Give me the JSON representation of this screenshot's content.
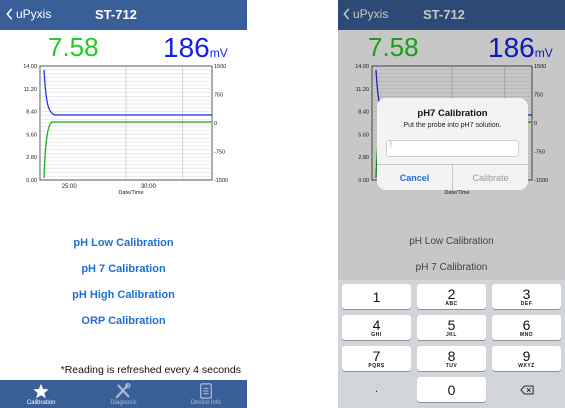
{
  "left": {
    "nav": {
      "back_label": "uPyxis",
      "title": "ST-712"
    },
    "readings": {
      "ph": "7.58",
      "mv": "186",
      "mv_unit": "mV"
    },
    "chart": {
      "left_ticks": [
        "14.00",
        "11.20",
        "8.40",
        "5.60",
        "2.80",
        "0.00"
      ],
      "right_ticks": [
        "1500",
        "750",
        "0",
        "-750",
        "-1500"
      ],
      "x_ticks": [
        "25:00",
        "30:00"
      ],
      "xlabel": "Date/Time"
    },
    "menu": [
      "pH Low Calibration",
      "pH 7 Calibration",
      "pH High Calibration",
      "ORP Calibration"
    ],
    "note": "*Reading is refreshed every 4 seconds",
    "tabs": [
      {
        "label": "Calibration",
        "icon": "star-icon",
        "active": true
      },
      {
        "label": "Diagnosis",
        "icon": "tools-icon",
        "active": false
      },
      {
        "label": "Device Info",
        "icon": "device-info-icon",
        "active": false
      }
    ]
  },
  "right": {
    "nav": {
      "back_label": "uPyxis",
      "title": "ST-712"
    },
    "readings": {
      "ph": "7.58",
      "mv": "186",
      "mv_unit": "mV"
    },
    "chart": {
      "left_ticks": [
        "14.00",
        "11.20",
        "8.40",
        "5.60",
        "2.80",
        "0.00"
      ],
      "right_ticks": [
        "1500",
        "750",
        "0",
        "-750",
        "-1500"
      ],
      "xlabel": "Date/Time"
    },
    "dialog": {
      "title": "pH7 Calibration",
      "message": "Put the probe into pH7 solution.",
      "input_value": "",
      "input_placeholder": "|",
      "cancel_label": "Cancel",
      "calibrate_label": "Calibrate"
    },
    "menu_behind": [
      "pH Low Calibration",
      "pH 7 Calibration"
    ],
    "keypad": [
      {
        "digit": "1",
        "letters": ""
      },
      {
        "digit": "2",
        "letters": "ABC"
      },
      {
        "digit": "3",
        "letters": "DEF"
      },
      {
        "digit": "4",
        "letters": "GHI"
      },
      {
        "digit": "5",
        "letters": "JKL"
      },
      {
        "digit": "6",
        "letters": "MNO"
      },
      {
        "digit": "7",
        "letters": "PQRS"
      },
      {
        "digit": "8",
        "letters": "TUV"
      },
      {
        "digit": "9",
        "letters": "WXYZ"
      },
      {
        "digit": ".",
        "letters": ""
      },
      {
        "digit": "0",
        "letters": ""
      },
      {
        "digit": "",
        "letters": ""
      }
    ],
    "keypad_icons": {
      "delete": "backspace-icon"
    }
  },
  "colors": {
    "nav_bar": "#3a5f98",
    "ph_green": "#22cc22",
    "mv_blue": "#1122ee",
    "link_blue": "#1e6fd6"
  }
}
